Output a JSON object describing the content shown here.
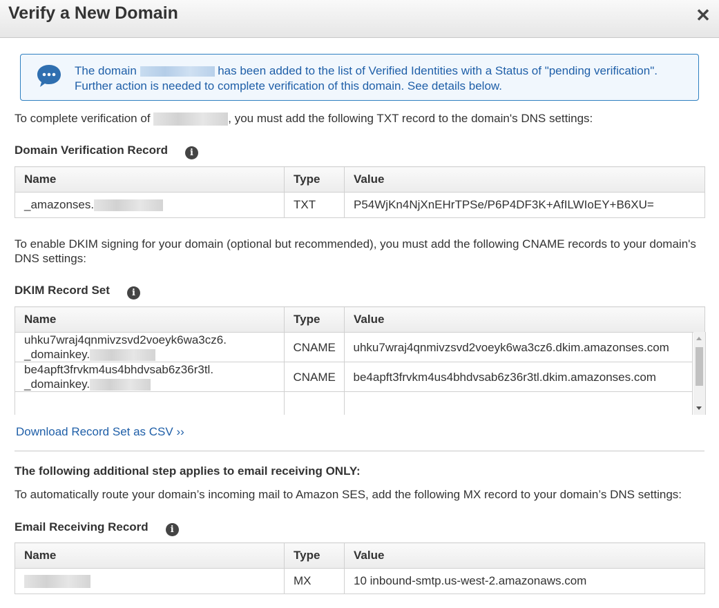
{
  "dialog": {
    "title": "Verify a New Domain",
    "close_glyph": "✕"
  },
  "info": {
    "text_before": "The domain ",
    "text_after": " has been added to the list of Verified Identities with a Status of \"pending verification\". Further action is needed to complete verification of this domain. See details below."
  },
  "txt_intro": {
    "before": "To complete verification of ",
    "after": ", you must add the following TXT record to the domain's DNS settings:"
  },
  "domain_verification": {
    "heading": "Domain Verification Record",
    "columns": [
      "Name",
      "Type",
      "Value"
    ],
    "row": {
      "name_prefix": "_amazonses.",
      "type": "TXT",
      "value": "P54WjKn4NjXnEHrTPSe/P6P4DF3K+AfILWIoEY+B6XU="
    }
  },
  "dkim_intro": "To enable DKIM signing for your domain (optional but recommended), you must add the following CNAME records to your domain's DNS settings:",
  "dkim": {
    "heading": "DKIM Record Set",
    "columns": [
      "Name",
      "Type",
      "Value"
    ],
    "rows": [
      {
        "name_line1": "uhku7wraj4qnmivzsvd2voeyk6wa3cz6.",
        "name_line2": "_domainkey.",
        "type": "CNAME",
        "value": "uhku7wraj4qnmivzsvd2voeyk6wa3cz6.dkim.amazonses.com"
      },
      {
        "name_line1": "be4apft3frvkm4us4bhdvsab6z36r3tl.",
        "name_line2": "_domainkey.",
        "type": "CNAME",
        "value": "be4apft3frvkm4us4bhdvsab6z36r3tl.dkim.amazonses.com"
      }
    ]
  },
  "download_link": "Download Record Set as CSV ››",
  "receiving": {
    "step_heading": "The following additional step applies to email receiving ONLY:",
    "intro": "To automatically route your domain’s incoming mail to Amazon SES, add the following MX record to your domain’s DNS settings:",
    "heading": "Email Receiving Record",
    "columns": [
      "Name",
      "Type",
      "Value"
    ],
    "row": {
      "type": "MX",
      "value": "10 inbound-smtp.us-west-2.amazonaws.com"
    }
  },
  "colors": {
    "link": "#1f5fa8",
    "info_border": "#2e7fc0",
    "info_bg": "#f1f7fd"
  },
  "icons": {
    "info_box": "speech-bubble-icon",
    "section_info": "info-icon"
  }
}
